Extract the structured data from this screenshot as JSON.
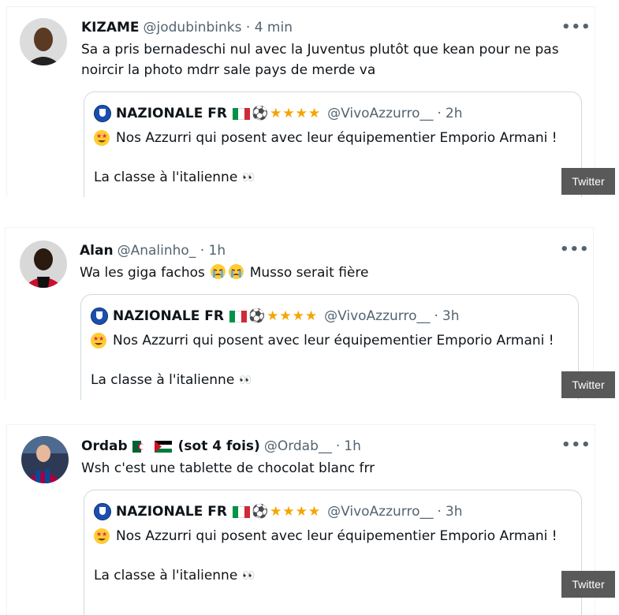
{
  "tweets": [
    {
      "author": "KIZAME",
      "handle": "@jodubinbinks",
      "separator": "·",
      "time": "4 min",
      "more": "•••",
      "text_line1": "Sa a pris bernadeschi nul avec la Juventus plutôt que kean pour ne pas",
      "text_line2": "noircir la photo mdrr sale pays de merde va",
      "quote": {
        "author": "NAZIONALE FR",
        "stars": "★★★★",
        "handle": "@VivoAzzurro__",
        "separator": "·",
        "time": "2h",
        "line1": "Nos Azzurri qui posent avec leur équipementier Emporio Armani !",
        "line2": "La classe à l'italienne"
      },
      "badge": "Twitter"
    },
    {
      "author": "Alan",
      "handle": "@Analinho_",
      "separator": "·",
      "time": "1h",
      "more": "•••",
      "text_pre": "Wa les giga fachos",
      "text_post": "Musso serait fière",
      "quote": {
        "author": "NAZIONALE FR",
        "stars": "★★★★",
        "handle": "@VivoAzzurro__",
        "separator": "·",
        "time": "3h",
        "line1": "Nos Azzurri qui posent avec leur équipementier Emporio Armani !",
        "line2": "La classe à l'italienne"
      },
      "badge": "Twitter"
    },
    {
      "author": "Ordab",
      "author_suffix": "(sot 4 fois)",
      "handle": "@Ordab__",
      "separator": "·",
      "time": "1h",
      "more": "•••",
      "text": "Wsh c'est une tablette de chocolat blanc frr",
      "quote": {
        "author": "NAZIONALE FR",
        "stars": "★★★★",
        "handle": "@VivoAzzurro__",
        "separator": "·",
        "time": "3h",
        "line1": "Nos Azzurri qui posent avec leur équipementier Emporio Armani !",
        "line2": "La classe à l'italienne"
      },
      "badge": "Twitter"
    }
  ],
  "colors": {
    "text": "#0f1419",
    "secondary": "#536471",
    "border": "#cfd9de",
    "star": "#f4a500",
    "badge_bg": "#595959",
    "italy_green": "#009246",
    "italy_red": "#ce2b37"
  },
  "icons": [
    "more-icon",
    "italy-flag-icon",
    "soccer-ball-icon",
    "star-icon",
    "star-struck-emoji-icon",
    "eyes-emoji-icon",
    "crying-emoji-icon",
    "algeria-flag-icon",
    "palestine-flag-icon",
    "crest-icon"
  ]
}
